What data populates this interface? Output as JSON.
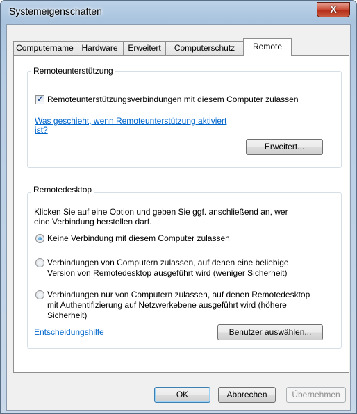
{
  "window": {
    "title": "Systemeigenschaften",
    "close_glyph": "X"
  },
  "tabs": [
    {
      "label": "Computername",
      "active": false
    },
    {
      "label": "Hardware",
      "active": false
    },
    {
      "label": "Erweitert",
      "active": false
    },
    {
      "label": "Computerschutz",
      "active": false
    },
    {
      "label": "Remote",
      "active": true
    }
  ],
  "remote_assistance": {
    "group_title": "Remoteunterstützung",
    "allow_checkbox_label": "Remoteunterstützungsverbindungen mit diesem Computer zulassen",
    "allow_checked": true,
    "help_link_line1": "Was geschieht, wenn Remoteunterstützung aktiviert",
    "help_link_line2": "ist?",
    "advanced_button": "Erweitert..."
  },
  "remote_desktop": {
    "group_title": "Remotedesktop",
    "intro_line1": "Klicken Sie auf eine Option und geben Sie ggf. anschließend an, wer",
    "intro_line2": "eine Verbindung herstellen darf.",
    "options": [
      {
        "lines": [
          "Keine Verbindung mit diesem Computer zulassen"
        ],
        "selected": true
      },
      {
        "lines": [
          "Verbindungen von Computern zulassen, auf denen eine beliebige",
          "Version von Remotedesktop ausgeführt wird (weniger Sicherheit)"
        ],
        "selected": false
      },
      {
        "lines": [
          "Verbindungen nur von Computern zulassen, auf denen Remotedesktop",
          "mit Authentifizierung auf Netzwerkebene ausgeführt wird (höhere",
          "Sicherheit)"
        ],
        "selected": false
      }
    ],
    "decision_help_link": "Entscheidungshilfe",
    "select_users_button": "Benutzer auswählen..."
  },
  "footer": {
    "ok": "OK",
    "cancel": "Abbrechen",
    "apply": "Übernehmen"
  },
  "colors": {
    "link": "#0066cc",
    "title_bar": "#a9c3de",
    "close_button": "#c9503a"
  },
  "icons": [
    "close-icon",
    "checkbox-checked-icon",
    "radio-selected-icon",
    "radio-unselected-icon"
  ]
}
